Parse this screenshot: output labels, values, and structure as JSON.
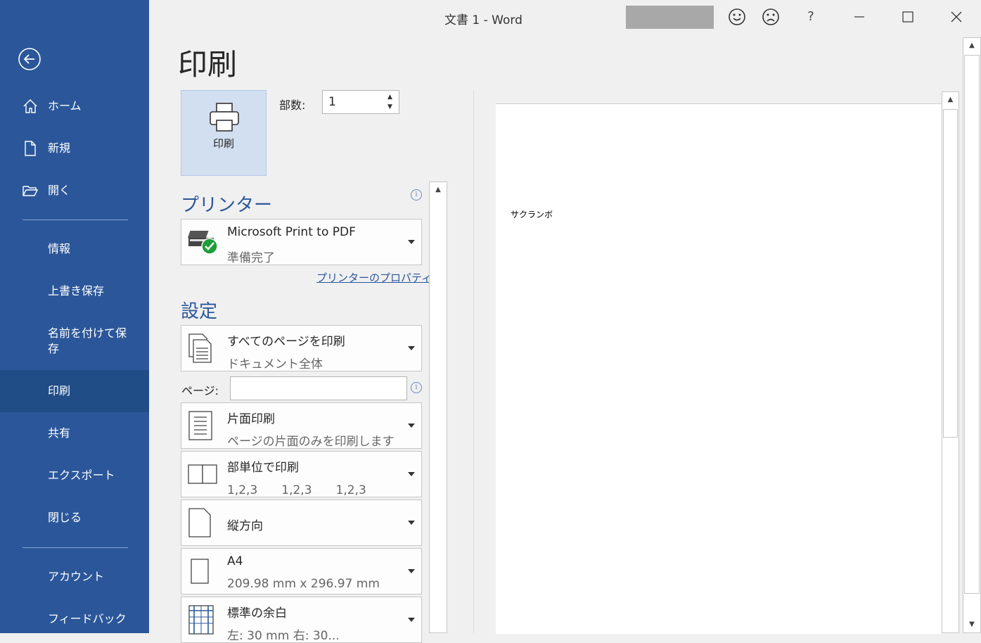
{
  "window": {
    "title": "文書 1 - Word"
  },
  "titlebar": {
    "help": "?"
  },
  "sidebar": {
    "items": [
      {
        "label": "ホーム",
        "icon": "home-icon"
      },
      {
        "label": "新規",
        "icon": "new-document-icon"
      },
      {
        "label": "開く",
        "icon": "open-folder-icon"
      },
      {
        "label": "情報"
      },
      {
        "label": "上書き保存"
      },
      {
        "label": "名前を付けて保存"
      },
      {
        "label": "印刷",
        "active": true
      },
      {
        "label": "共有"
      },
      {
        "label": "エクスポート"
      },
      {
        "label": "閉じる"
      },
      {
        "label": "アカウント"
      },
      {
        "label": "フィードバック"
      }
    ]
  },
  "print": {
    "heading": "印刷",
    "print_button": "印刷",
    "copies_label": "部数:",
    "copies_value": "1",
    "printer_section": "プリンター",
    "printer_name": "Microsoft Print to PDF",
    "printer_status": "準備完了",
    "printer_properties": "プリンターのプロパティ",
    "settings_section": "設定",
    "pages_label": "ページ:",
    "pages_value": "",
    "settings": [
      {
        "title": "すべてのページを印刷",
        "subtitle": "ドキュメント全体",
        "icon": "document-pages-icon"
      },
      {
        "title": "片面印刷",
        "subtitle": "ページの片面のみを印刷します",
        "icon": "one-sided-icon"
      },
      {
        "title": "部単位で印刷",
        "subtitle": "1,2,3　　1,2,3　　1,2,3",
        "icon": "collated-icon"
      },
      {
        "title": "縦方向",
        "subtitle": "",
        "icon": "portrait-icon"
      },
      {
        "title": "A4",
        "subtitle": "209.98 mm x 296.97 mm",
        "icon": "paper-size-icon"
      },
      {
        "title": "標準の余白",
        "subtitle": "左:  30 mm    右:  30...",
        "icon": "margins-icon"
      }
    ]
  },
  "preview": {
    "text": "サクランボ"
  },
  "colors": {
    "sidebar": "#2b579a",
    "active": "#214d86",
    "accent": "#2b579a"
  }
}
